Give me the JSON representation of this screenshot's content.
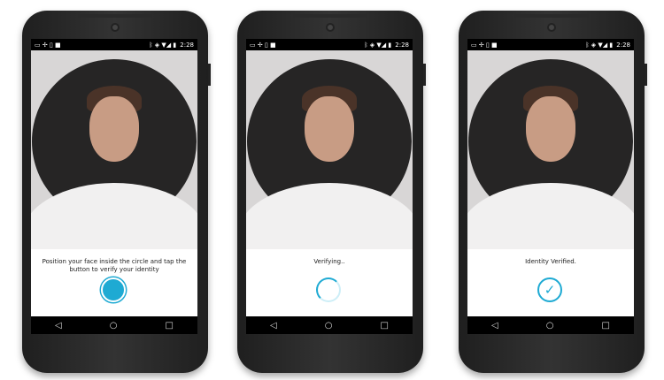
{
  "status_bar": {
    "time": "2:28",
    "left_icons": [
      "screenshot-icon",
      "pinwheel-icon",
      "phone-icon",
      "android-icon"
    ],
    "right_icons": [
      "bluetooth-icon",
      "vibrate-icon",
      "wifi-icon",
      "signal-icon",
      "battery-icon"
    ]
  },
  "screens": [
    {
      "state": "idle",
      "message": "Position your face inside the circle and tap the button to verify your identity",
      "action": "capture-button"
    },
    {
      "state": "verifying",
      "message": "Verifying..",
      "action": "spinner"
    },
    {
      "state": "verified",
      "message": "Identity Verified.",
      "action": "check",
      "check_glyph": "✓"
    }
  ],
  "nav": {
    "back": "◁",
    "home": "○",
    "recents": "□"
  },
  "colors": {
    "accent": "#1eaad3",
    "circle_bg": "#262525",
    "screen_bg": "#d8d6d6"
  }
}
